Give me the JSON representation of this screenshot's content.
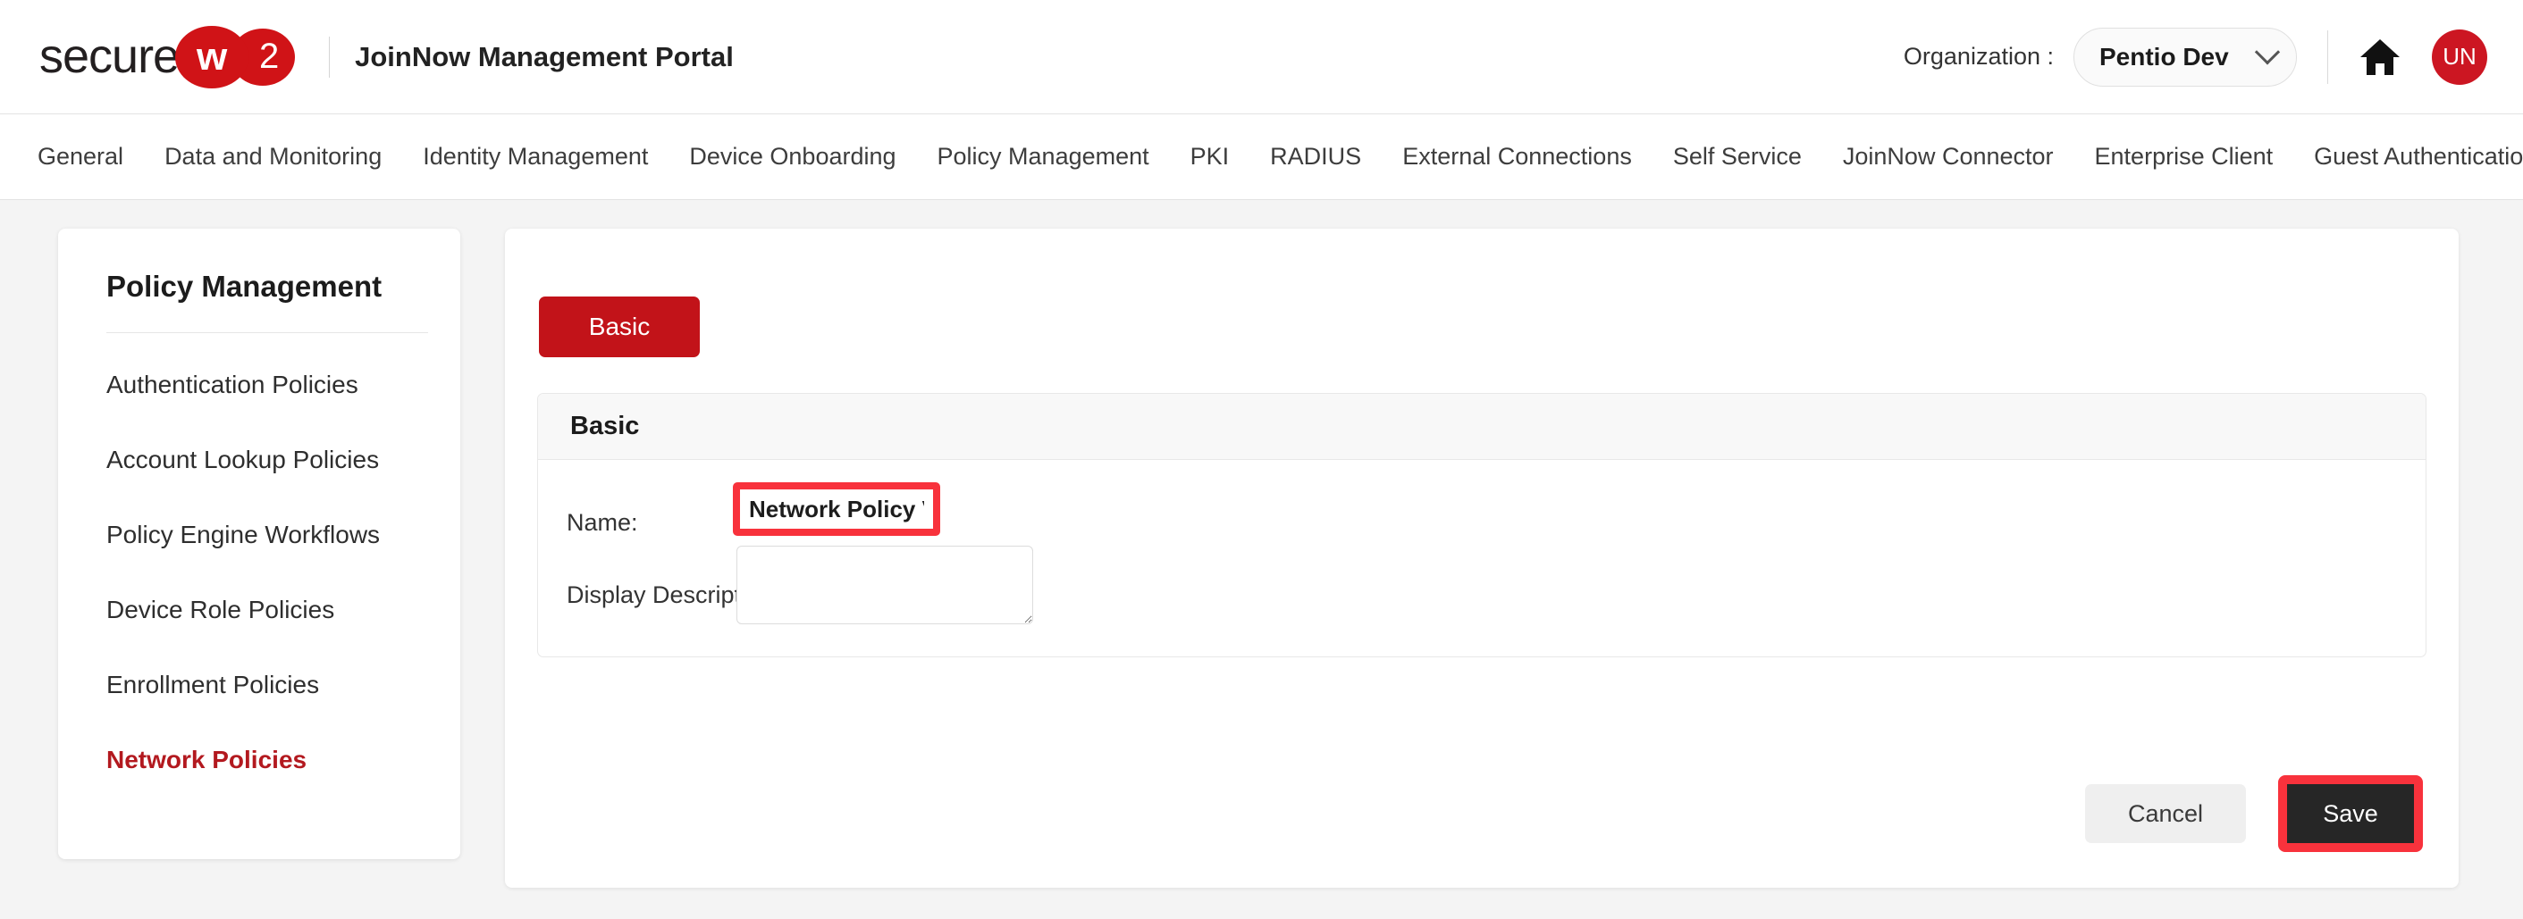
{
  "header": {
    "logo_text": "secure",
    "logo_bubble_w": "w",
    "logo_bubble_2": "2",
    "portal_title": "JoinNow Management Portal",
    "organization_label": "Organization :",
    "organization_value": "Pentio Dev",
    "home_icon": "home-icon",
    "avatar_initials": "UN",
    "brand_red": "#d01317",
    "avatar_red": "#cc1622"
  },
  "nav": {
    "items": [
      "General",
      "Data and Monitoring",
      "Identity Management",
      "Device Onboarding",
      "Policy Management",
      "PKI",
      "RADIUS",
      "External Connections",
      "Self Service",
      "JoinNow Connector",
      "Enterprise Client",
      "Guest Authentication"
    ]
  },
  "sidebar": {
    "title": "Policy Management",
    "items": [
      {
        "label": "Authentication Policies",
        "active": false
      },
      {
        "label": "Account Lookup Policies",
        "active": false
      },
      {
        "label": "Policy Engine Workflows",
        "active": false
      },
      {
        "label": "Device Role Policies",
        "active": false
      },
      {
        "label": "Enrollment Policies",
        "active": false
      },
      {
        "label": "Network Policies",
        "active": true
      }
    ],
    "active_color": "#b3191f"
  },
  "main": {
    "tab_label": "Basic",
    "card_title": "Basic",
    "fields": {
      "name_label": "Name:",
      "name_value": "Network Policy VLAN",
      "name_placeholder": "",
      "description_label": "Display Description:",
      "description_value": "",
      "description_placeholder": ""
    },
    "buttons": {
      "cancel_label": "Cancel",
      "save_label": "Save"
    },
    "highlight_color": "#f8323c",
    "tab_color": "#c21319",
    "save_bg": "#262626"
  }
}
